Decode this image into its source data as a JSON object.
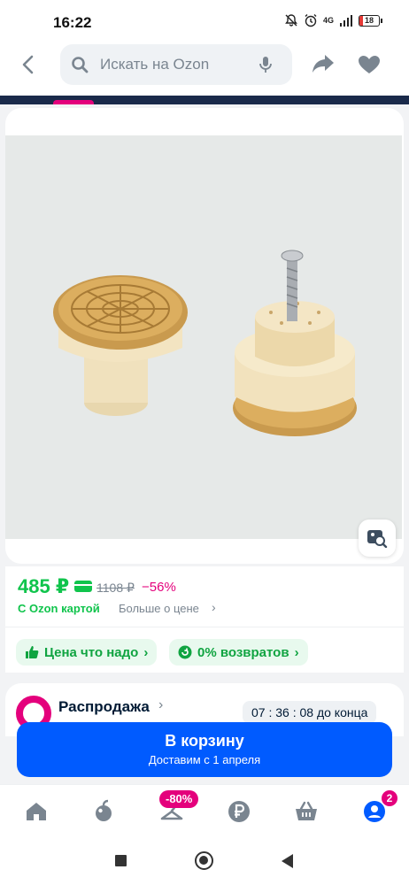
{
  "status_bar": {
    "time": "16:22",
    "network": "4G",
    "battery": "18"
  },
  "search": {
    "placeholder": "Искать на Ozon"
  },
  "price": {
    "current": "485 ₽",
    "old": "1108 ₽",
    "discount": "−56%",
    "ozon_card_label": "С Ozon картой",
    "more_label": "Больше о цене",
    "chevron": "›"
  },
  "chips": [
    {
      "label": "Цена что надо",
      "chevron": "›"
    },
    {
      "label": "0% возвратов",
      "chevron": "›"
    }
  ],
  "sale": {
    "title": "Распродажа",
    "chevron": "›",
    "timer": "07 : 36 : 08 до конца"
  },
  "cart": {
    "label": "В корзину",
    "delivery": "Доставим с 1 апреля"
  },
  "nav": {
    "discount_badge": "-80%",
    "cart_count": "2"
  },
  "colors": {
    "accent": "#005bff",
    "green": "#10c44c",
    "pink": "#e4007c"
  }
}
